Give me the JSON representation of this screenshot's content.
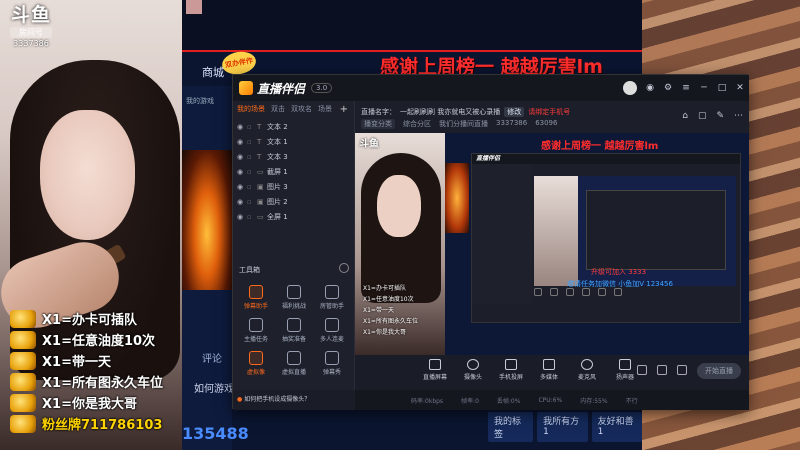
{
  "cam": {
    "logo": "斗鱼",
    "room_label": "房间号",
    "room_number": "3337386",
    "gifts": [
      {
        "text": "X1=办卡可插队",
        "icon": "gift-car-icon"
      },
      {
        "text": "X1=任意油度10次",
        "icon": "gift-plane-icon"
      },
      {
        "text": "X1=带一天",
        "icon": "gift-trophy-icon"
      },
      {
        "text": "X1=所有图永久车位",
        "icon": "gift-card-icon"
      },
      {
        "text": "X1=你是我大哥",
        "icon": "gift-crown-icon"
      },
      {
        "text": "粉丝牌711786103",
        "icon": "fan-badge-icon"
      }
    ]
  },
  "site": {
    "shop_label": "商城",
    "shop_badge": "双办伴作",
    "my_game": "我的游戏",
    "comment_label": "评论",
    "how_play": "如何游戏",
    "hot_number": "135488",
    "rewards": [
      "我的标签",
      "我所有方1",
      "友好和善1"
    ]
  },
  "banner": {
    "thanks": "感谢上周榜一 越越厉害lm"
  },
  "app": {
    "name": "直播伴侣",
    "version": "3.0",
    "left_tabs": [
      "我的场景",
      "双击",
      "双攻名",
      "场景"
    ],
    "scenes": [
      "文本 2",
      "文本 1",
      "文本 3",
      "截屏 1",
      "图片 3",
      "图片 2",
      "全屏 1"
    ],
    "tools_title": "工具箱",
    "tools": [
      {
        "name": "弹幕助手",
        "hot": true
      },
      {
        "name": "福利挑战",
        "hot": false
      },
      {
        "name": "房管助手",
        "hot": false
      },
      {
        "name": "主播任务",
        "hot": false
      },
      {
        "name": "抽奖准备",
        "hot": false
      },
      {
        "name": "多人连麦",
        "hot": false
      },
      {
        "name": "虚拟像",
        "hot": true
      },
      {
        "name": "虚拟直播",
        "hot": false
      },
      {
        "name": "弹幕秀",
        "hot": false
      }
    ],
    "stream": {
      "title_label": "直播名字：",
      "title": "一起刷刷刷 我亦就电又被心录播",
      "tag": "修改",
      "warn": "请绑定手机号",
      "category_label": "播变分类",
      "category": "综合分区",
      "link": "我们分播间直播",
      "room_id": "3337386",
      "hot": "63096"
    },
    "preview": {
      "logo": "斗鱼",
      "gifts": [
        "X1=办卡可插队",
        "X1=任意油度10次",
        "X1=带一天",
        "X1=所有图永久车位",
        "X1=你是我大哥"
      ],
      "thanks": "感谢上周榜一 越越厉害lm",
      "red_text": "升级可加入 3333",
      "blue_text": "邀请任务加微信 小鱼加V 123456"
    },
    "controls": [
      "直播屏幕",
      "摄像头",
      "手机投屏",
      "多媒体",
      "麦克风",
      "扬声器"
    ],
    "start_label": "开始直播",
    "notice": "如何把手机设成摄像头？",
    "status": [
      "码率:0kbps",
      "帧率:0",
      "丢帧:0%",
      "CPU:6%",
      "内存:55%",
      "不行"
    ]
  }
}
